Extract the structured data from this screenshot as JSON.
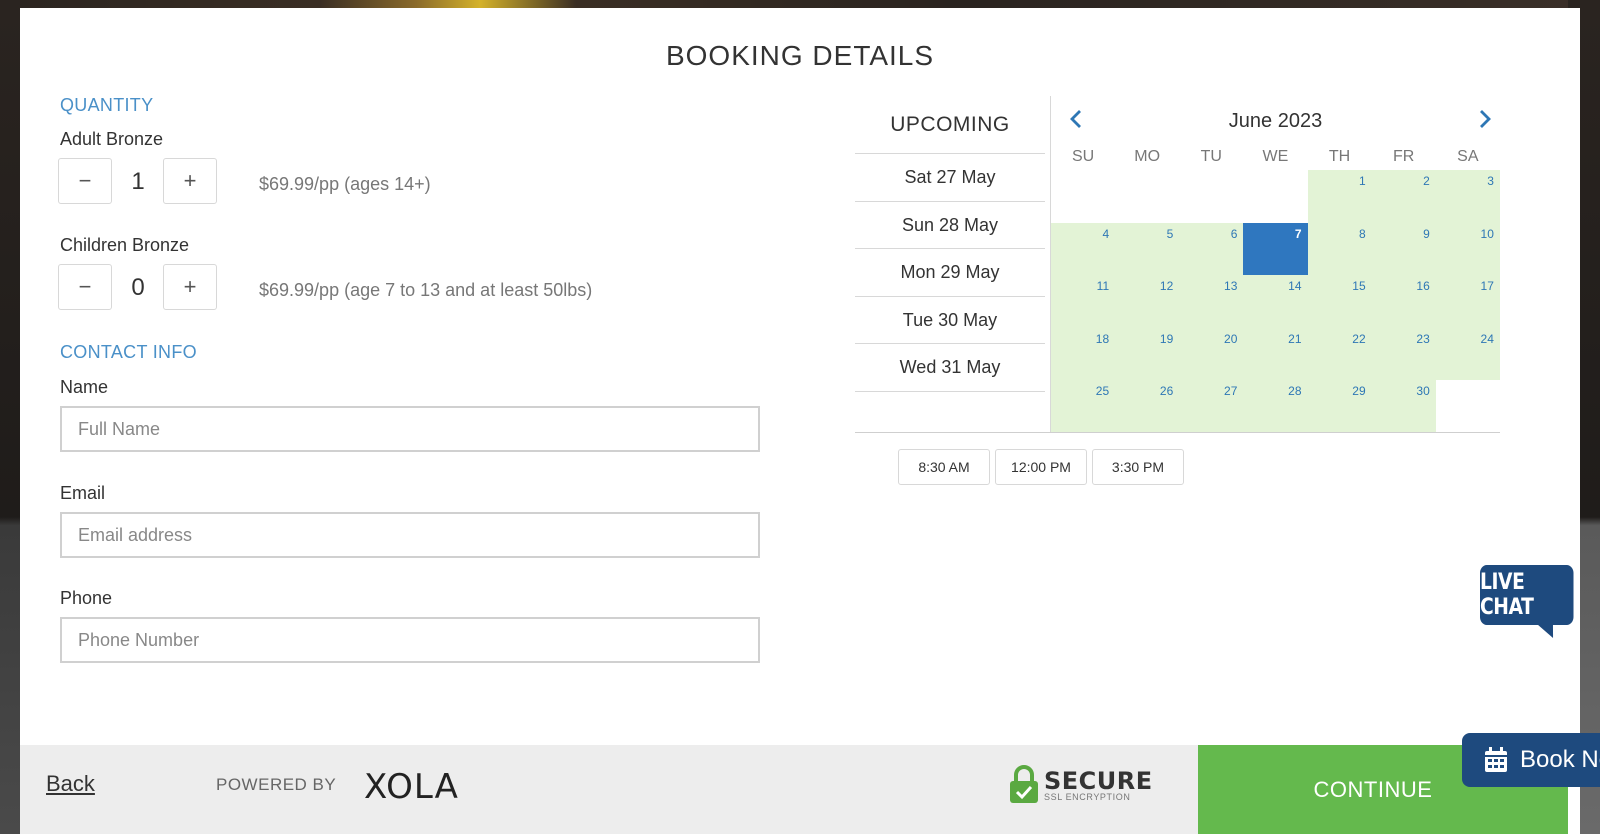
{
  "title": "BOOKING DETAILS",
  "quantity": {
    "section_label": "QUANTITY",
    "adult": {
      "label": "Adult Bronze",
      "value": "1",
      "price": "$69.99/pp (ages 14+)",
      "minus": "−",
      "plus": "+"
    },
    "children": {
      "label": "Children Bronze",
      "value": "0",
      "price": "$69.99/pp (age 7 to 13 and at least 50lbs)",
      "minus": "−",
      "plus": "+"
    }
  },
  "contact": {
    "section_label": "CONTACT INFO",
    "name_label": "Name",
    "name_placeholder": "Full Name",
    "email_label": "Email",
    "email_placeholder": "Email address",
    "phone_label": "Phone",
    "phone_placeholder": "Phone Number"
  },
  "upcoming": {
    "header": "UPCOMING",
    "items": [
      "Sat 27 May",
      "Sun 28 May",
      "Mon 29 May",
      "Tue 30 May",
      "Wed 31 May"
    ]
  },
  "calendar": {
    "month": "June 2023",
    "days_of_week": [
      "SU",
      "MO",
      "TU",
      "WE",
      "TH",
      "FR",
      "SA"
    ],
    "first_weekday_index": 4,
    "days_in_month": 30,
    "selected_day": 7,
    "available_color": "#e3f3d6",
    "selected_color": "#2f77bf"
  },
  "times": [
    "8:30 AM",
    "12:00 PM",
    "3:30 PM"
  ],
  "footer": {
    "back": "Back",
    "powered_by": "POWERED BY",
    "brand": "XOLA",
    "secure": "SECURE",
    "secure_sub": "SSL ENCRYPTION",
    "continue": "CONTINUE"
  },
  "widgets": {
    "live_chat": "LIVE CHAT",
    "book_now": "Book Now"
  },
  "colors": {
    "accent": "#4a90c8",
    "continue_bg": "#64b94d",
    "widget_bg": "#1e4a7e"
  }
}
